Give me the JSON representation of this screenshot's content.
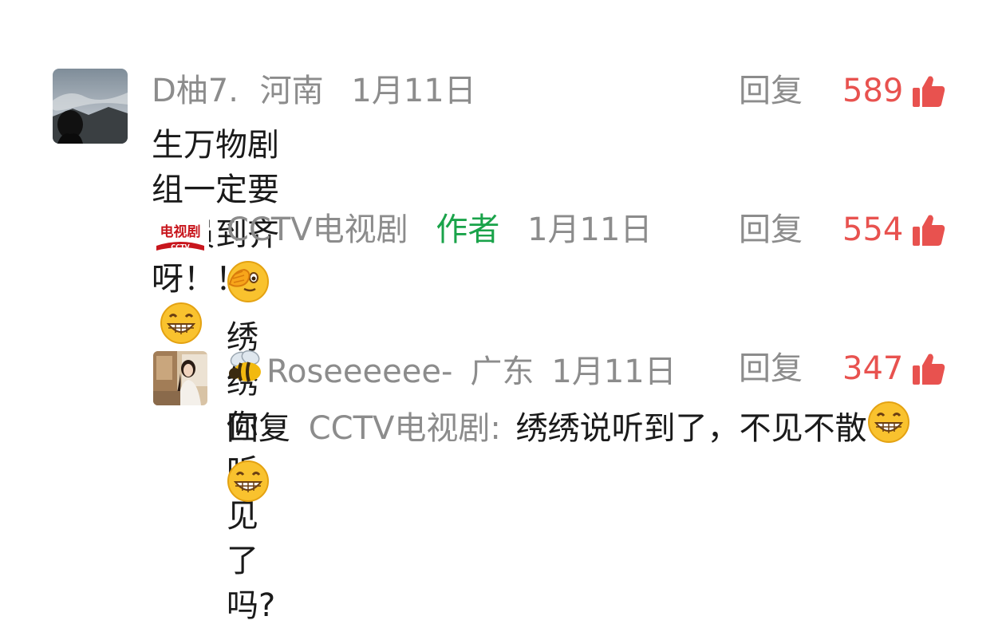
{
  "comments": [
    {
      "username": "D柚7.",
      "location": "河南",
      "date": "1月11日",
      "reply_label": "回复",
      "likes": "589",
      "text": "生万物剧组一定要全员到齐呀！！！",
      "avatar": "mountain-photo-avatar",
      "emojis": [
        "grinning-emoji"
      ]
    },
    {
      "username": "CCTV电视剧",
      "badge": "作者",
      "date": "1月11日",
      "reply_label": "回复",
      "likes": "554",
      "text": "绣绣你听见了吗?",
      "avatar": "cctv-logo-avatar",
      "avatar_logo_text": "电视剧",
      "avatar_logo_sub": "CCTV",
      "emojis": [
        "peeking-emoji"
      ]
    },
    {
      "username": "Roseeeeee-",
      "location": "广东",
      "date": "1月11日",
      "reply_label": "回复",
      "likes": "347",
      "reply_prefix": "回复",
      "reply_target": "CCTV电视剧:",
      "text": "绣绣说听到了，不见不散",
      "avatar": "woman-photo-avatar",
      "emojis": [
        "bee-emoji",
        "grinning-emoji",
        "grinning-emoji"
      ]
    }
  ],
  "colors": {
    "likes": "#e8524f",
    "meta": "#8c8c8c",
    "author_badge": "#1aa34a",
    "text": "#1a1a1a"
  }
}
